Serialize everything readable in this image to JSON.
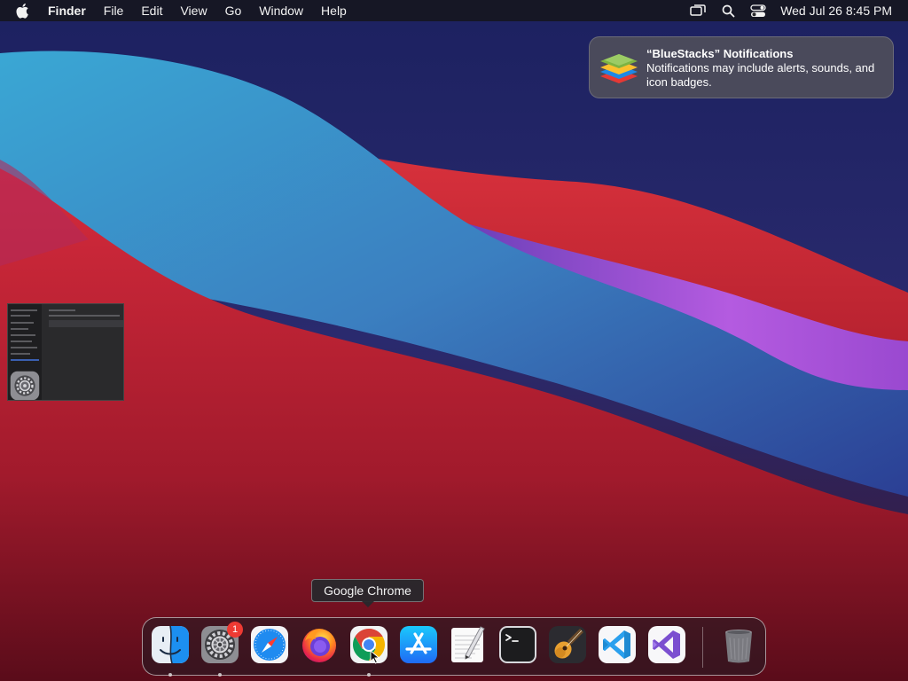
{
  "menubar": {
    "app_name": "Finder",
    "items": [
      "File",
      "Edit",
      "View",
      "Go",
      "Window",
      "Help"
    ],
    "status_icons": [
      "screen-mirroring-icon",
      "search-icon",
      "control-center-icon"
    ],
    "clock": "Wed Jul 26  8:45 PM"
  },
  "notification": {
    "title": "“BlueStacks” Notifications",
    "body": "Notifications may include alerts, sounds, and icon badges.",
    "app_icon": "bluestacks-icon"
  },
  "tooltip": {
    "label": "Google Chrome"
  },
  "dock": {
    "items": [
      {
        "name": "finder",
        "icon": "finder-icon",
        "running": true
      },
      {
        "name": "system-settings",
        "icon": "gear-icon",
        "running": true,
        "badge": "1"
      },
      {
        "name": "safari",
        "icon": "compass-icon",
        "running": false
      },
      {
        "name": "firefox",
        "icon": "firefox-icon",
        "running": false
      },
      {
        "name": "chrome",
        "icon": "chrome-icon",
        "running": true
      },
      {
        "name": "app-store",
        "icon": "app-store-icon",
        "running": false
      },
      {
        "name": "textedit",
        "icon": "textedit-icon",
        "running": false
      },
      {
        "name": "terminal",
        "icon": "terminal-icon",
        "running": false
      },
      {
        "name": "garageband",
        "icon": "guitar-icon",
        "running": false
      },
      {
        "name": "vscode",
        "icon": "vscode-icon",
        "running": false
      },
      {
        "name": "visual-studio",
        "icon": "visual-studio-icon",
        "running": false
      },
      {
        "name": "trash",
        "icon": "trash-icon",
        "running": false
      }
    ]
  },
  "colors": {
    "wallpaper_blue": "#2f9fc9",
    "wallpaper_red": "#c6263a",
    "wallpaper_purple": "#a550d8",
    "badge_red": "#ee3a33"
  }
}
